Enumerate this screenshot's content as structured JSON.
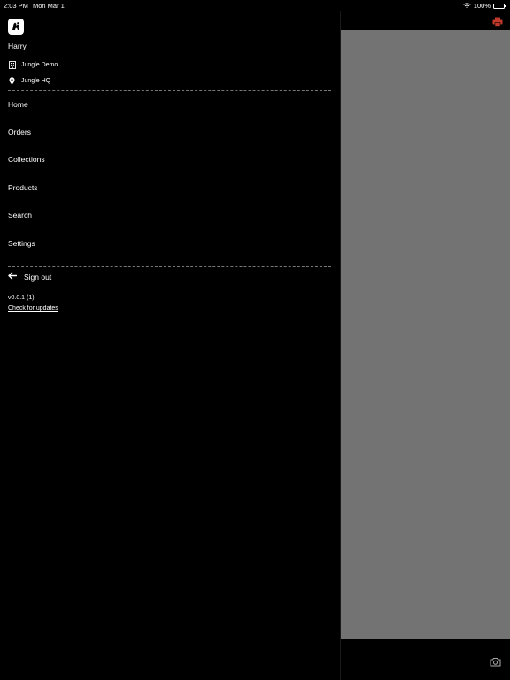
{
  "status_bar": {
    "time": "2:03 PM",
    "date": "Mon Mar 1",
    "battery_text": "100%",
    "battery_level": 1.0
  },
  "drawer": {
    "logo_icon": "app-logo-icon",
    "user_name": "Harry",
    "organization": "Jungle Demo",
    "location": "Jungle HQ",
    "nav_items": [
      {
        "label": "Home"
      },
      {
        "label": "Orders"
      },
      {
        "label": "Collections"
      },
      {
        "label": "Products"
      },
      {
        "label": "Search"
      },
      {
        "label": "Settings"
      }
    ],
    "sign_out_label": "Sign out",
    "version": "v0.0.1 (1)",
    "check_updates_label": "Check for updates"
  },
  "right_pane": {
    "print_icon": "printer-icon",
    "print_icon_color": "#c0392b",
    "camera_icon": "camera-icon",
    "content_color": "#737373"
  }
}
